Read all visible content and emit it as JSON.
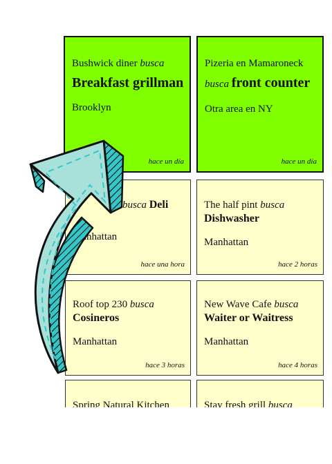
{
  "cards": [
    {
      "company": "Bushwick diner",
      "verb": "busca",
      "role": "Breakfast grillman",
      "location": "Brooklyn",
      "time": "hace un día"
    },
    {
      "company": "Pizeria en Mamaroneck",
      "verb": "busca",
      "role": "front counter",
      "location": "Otra area en NY",
      "time": "hace un día"
    },
    {
      "company": "",
      "verb": "busca",
      "role": "Deli",
      "location": "Manhattan",
      "time": "hace una hora"
    },
    {
      "company": "The half pint",
      "verb": "busca",
      "role": "Dishwasher",
      "location": "Manhattan",
      "time": "hace 2 horas"
    },
    {
      "company": "Roof top 230",
      "verb": "busca",
      "role": "Cosineros",
      "location": "Manhattan",
      "time": "hace 3 horas"
    },
    {
      "company": "New Wave Cafe",
      "verb": "busca",
      "role": "Waiter or Waitress",
      "location": "Manhattan",
      "time": "hace 4 horas"
    },
    {
      "company": "Spring Natural Kitchen",
      "verb": "",
      "role": "",
      "location": "",
      "time": ""
    },
    {
      "company": "Stay fresh grill",
      "verb": "busca",
      "role": "",
      "location": "",
      "time": ""
    }
  ],
  "colors": {
    "featured": "#7fff00",
    "normal": "#ffffcc",
    "arrow_fill": "#a8e0da",
    "arrow_side": "#35c7c7"
  },
  "icons": {
    "overlay": "curved-up-arrow-icon"
  }
}
